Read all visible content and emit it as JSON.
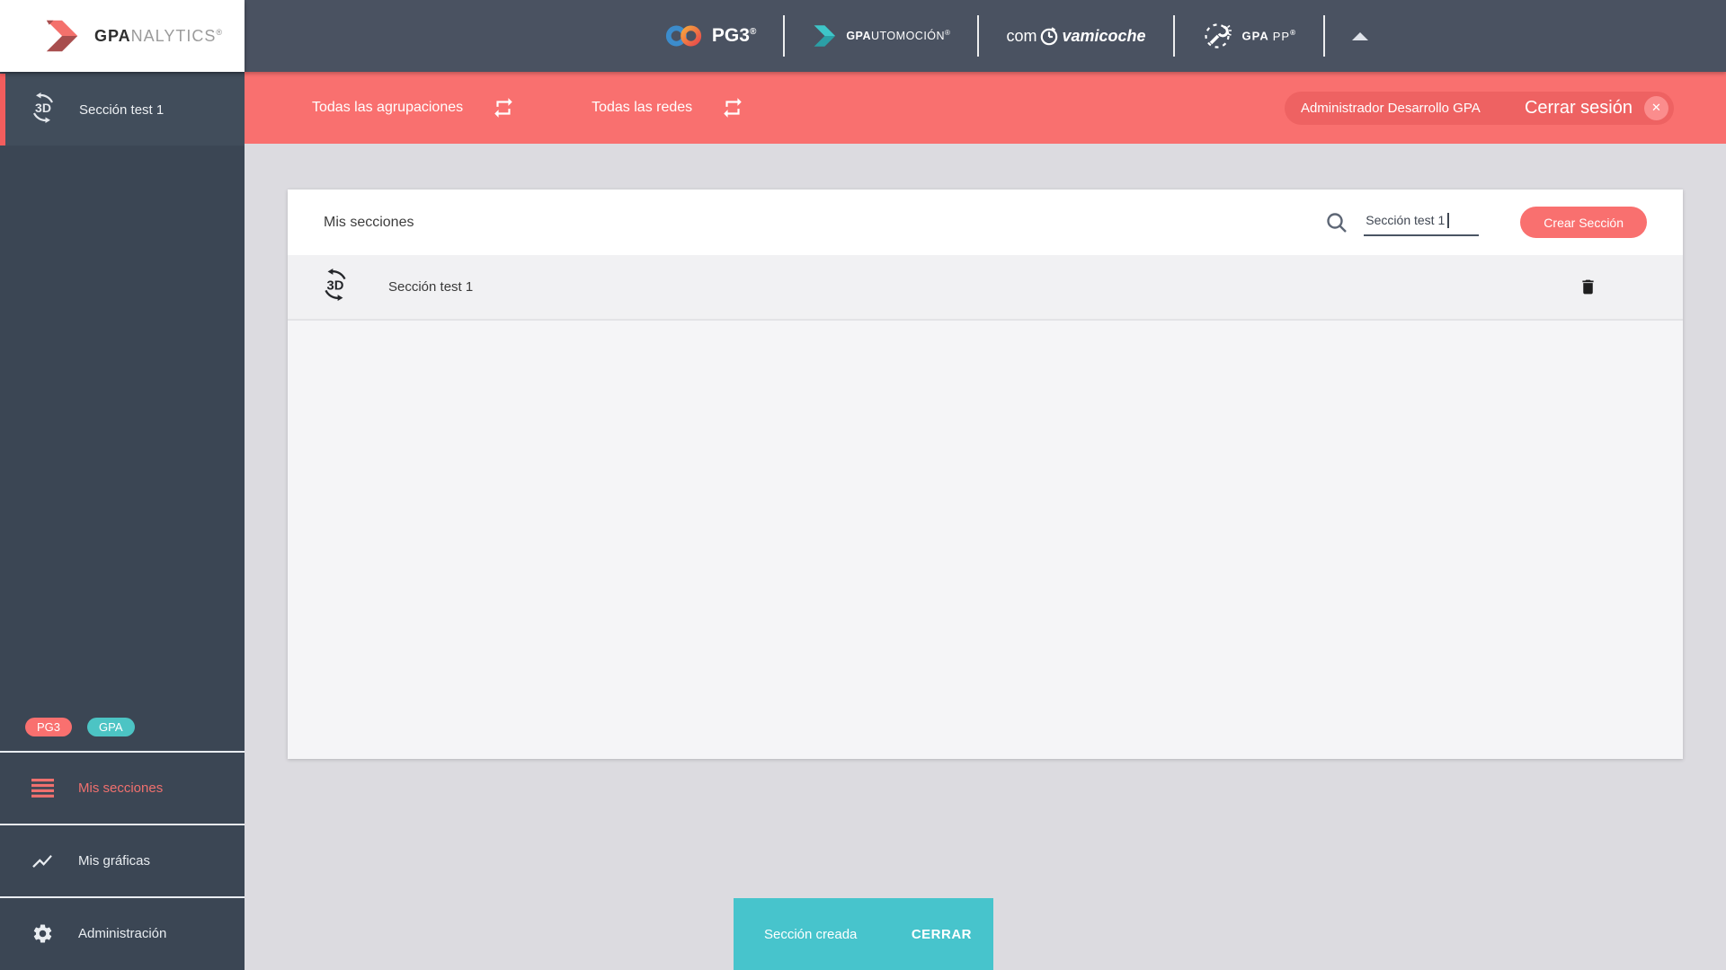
{
  "sidebar": {
    "logo": {
      "bold": "GPA",
      "rest": "NALYTICS",
      "reg": "®"
    },
    "active_item": "Sección test 1",
    "badges": [
      {
        "label": "PG3"
      },
      {
        "label": "GPA"
      }
    ],
    "menu": [
      {
        "label": "Mis secciones"
      },
      {
        "label": "Mis gráficas"
      },
      {
        "label": "Administración"
      }
    ]
  },
  "header": {
    "pg3": {
      "text": "PG3",
      "reg": "®"
    },
    "automocion": {
      "bold": "GPA",
      "rest": "UTOMOCIÓN",
      "reg": "®"
    },
    "comvamicoche": {
      "prefix": "com",
      "suffix": "vamicoche"
    },
    "gpapp": {
      "text": "GPA",
      "text2": "PP",
      "reg": "®"
    }
  },
  "filter_bar": {
    "filters": [
      {
        "label": "Todas las agrupaciones"
      },
      {
        "label": "Todas las redes"
      }
    ],
    "user": "Administrador Desarrollo GPA",
    "logout": "Cerrar sesión",
    "close_glyph": "✕"
  },
  "content": {
    "title": "Mis secciones",
    "search_value": "Sección test 1",
    "create_button": "Crear Sección",
    "rows": [
      {
        "name": "Sección test 1"
      }
    ]
  },
  "toast": {
    "message": "Sección creada",
    "action": "CERRAR"
  },
  "colors": {
    "accent": "#f9706f",
    "teal": "#47c4cc",
    "header": "#4a5261",
    "sidebar": "#3b4654"
  }
}
